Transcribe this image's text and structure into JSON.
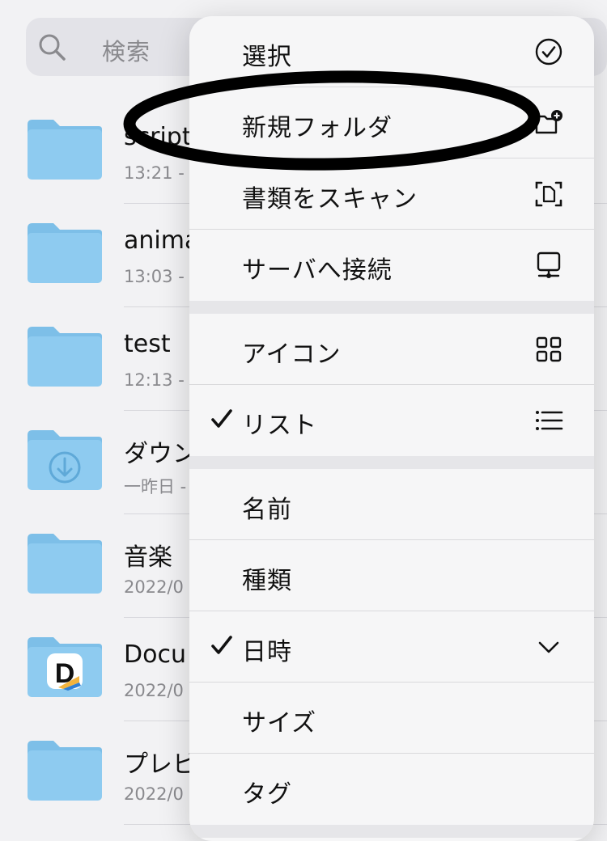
{
  "search": {
    "placeholder": "検索"
  },
  "files": [
    {
      "name": "script",
      "sub": "13:21 -",
      "kind": "folder"
    },
    {
      "name": "anima",
      "sub": "13:03 -",
      "kind": "folder"
    },
    {
      "name": "test",
      "sub": "12:13 -",
      "kind": "folder"
    },
    {
      "name": "ダウン",
      "sub": "一昨日 -",
      "kind": "downloads-folder"
    },
    {
      "name": "音楽",
      "sub": "2022/0",
      "kind": "folder"
    },
    {
      "name": "Docu",
      "sub": "2022/0",
      "kind": "documents-app-folder"
    },
    {
      "name": "プレビ",
      "sub": "2022/0",
      "kind": "folder"
    }
  ],
  "menu": {
    "items": [
      {
        "label": "選択",
        "icon": "checkmark-circle-icon",
        "checked": false
      },
      {
        "label": "新規フォルダ",
        "icon": "folder-plus-icon",
        "checked": false
      },
      {
        "label": "書類をスキャン",
        "icon": "scan-document-icon",
        "checked": false
      },
      {
        "label": "サーバへ接続",
        "icon": "server-display-icon",
        "checked": false
      },
      {
        "label": "アイコン",
        "icon": "grid-icon",
        "checked": false
      },
      {
        "label": "リスト",
        "icon": "list-icon",
        "checked": true
      },
      {
        "label": "名前",
        "icon": "",
        "checked": false
      },
      {
        "label": "種類",
        "icon": "",
        "checked": false
      },
      {
        "label": "日時",
        "icon": "chevron-down-icon",
        "checked": true
      },
      {
        "label": "サイズ",
        "icon": "",
        "checked": false
      },
      {
        "label": "タグ",
        "icon": "",
        "checked": false
      }
    ]
  },
  "colors": {
    "folder": "#8ecbf0",
    "folder_tab": "#7dbfe8",
    "menu_bg": "#f6f6f7",
    "annotation": "#000000"
  }
}
